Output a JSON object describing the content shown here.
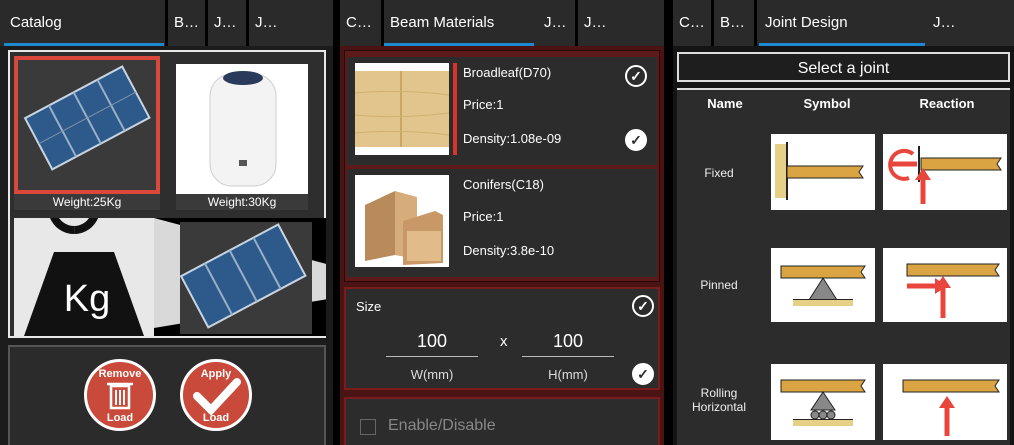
{
  "panel1": {
    "tabs": [
      "Catalog",
      "Be...",
      "Joi...",
      "Joi..."
    ],
    "items": [
      {
        "name": "solar-panel",
        "weight": "Weight:25Kg"
      },
      {
        "name": "water-heater",
        "weight": "Weight:30Kg"
      }
    ],
    "kg_symbol": "Kg",
    "remove_button": {
      "line1": "Remove",
      "line2": "Load"
    },
    "apply_button": {
      "line1": "Apply",
      "line2": "Load"
    }
  },
  "panel2": {
    "tabs": [
      "Cat...",
      "Beam Materials",
      "Joi...",
      "Joi..."
    ],
    "materials": [
      {
        "name": "Broadleaf(D70)",
        "price": "Price:1",
        "density": "Density:1.08e-09"
      },
      {
        "name": "Conifers(C18)",
        "price": "Price:1",
        "density": "Density:3.8e-10"
      }
    ],
    "size": {
      "label": "Size",
      "width_value": "100",
      "height_value": "100",
      "separator": "x",
      "width_unit": "W(mm)",
      "height_unit": "H(mm)"
    },
    "enable_label": "Enable/Disable"
  },
  "panel3": {
    "tabs": [
      "Cat...",
      "Be...",
      "Joint Design",
      "Joi..."
    ],
    "header": "Select a joint",
    "columns": [
      "Name",
      "Symbol",
      "Reaction"
    ],
    "joints": [
      {
        "name": "Fixed"
      },
      {
        "name": "Pinned"
      },
      {
        "name": "Rolling Horizontal"
      }
    ]
  },
  "colors": {
    "accent": "#1e88d0",
    "selection_red": "#d9332a",
    "button_red": "#c94a3a",
    "beam_orange": "#d9a441",
    "reaction_red": "#e8453c"
  }
}
